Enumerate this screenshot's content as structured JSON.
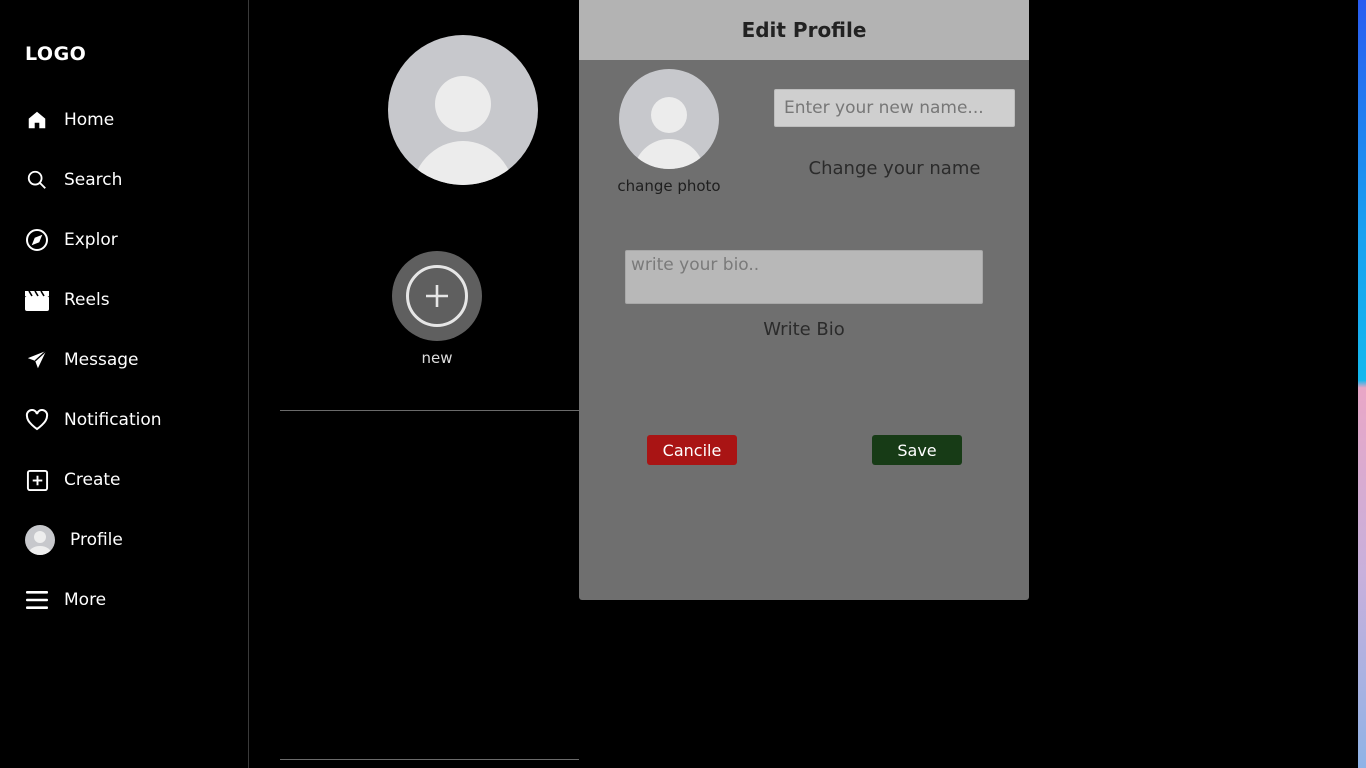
{
  "sidebar": {
    "logo": "LOGO",
    "items": [
      {
        "label": "Home",
        "icon": "home-icon"
      },
      {
        "label": "Search",
        "icon": "search-icon"
      },
      {
        "label": "Explor",
        "icon": "compass-icon"
      },
      {
        "label": "Reels",
        "icon": "clapperboard-icon"
      },
      {
        "label": "Message",
        "icon": "send-icon"
      },
      {
        "label": "Notification",
        "icon": "heart-icon"
      },
      {
        "label": "Create",
        "icon": "plus-square-icon"
      },
      {
        "label": "Profile",
        "icon": "avatar"
      },
      {
        "label": "More",
        "icon": "menu-icon"
      }
    ]
  },
  "profile": {
    "new_story_label": "new"
  },
  "modal": {
    "title": "Edit Profile",
    "change_photo": "change photo",
    "name_placeholder": "Enter your new name...",
    "name_label": "Change your name",
    "bio_placeholder": "write your bio..",
    "bio_label": "Write Bio",
    "cancel_label": "Cancile",
    "save_label": "Save"
  },
  "colors": {
    "cancel": "#a91414",
    "save": "#173b16",
    "modal_bg": "#6f6f6f",
    "modal_header": "#b3b3b3"
  }
}
